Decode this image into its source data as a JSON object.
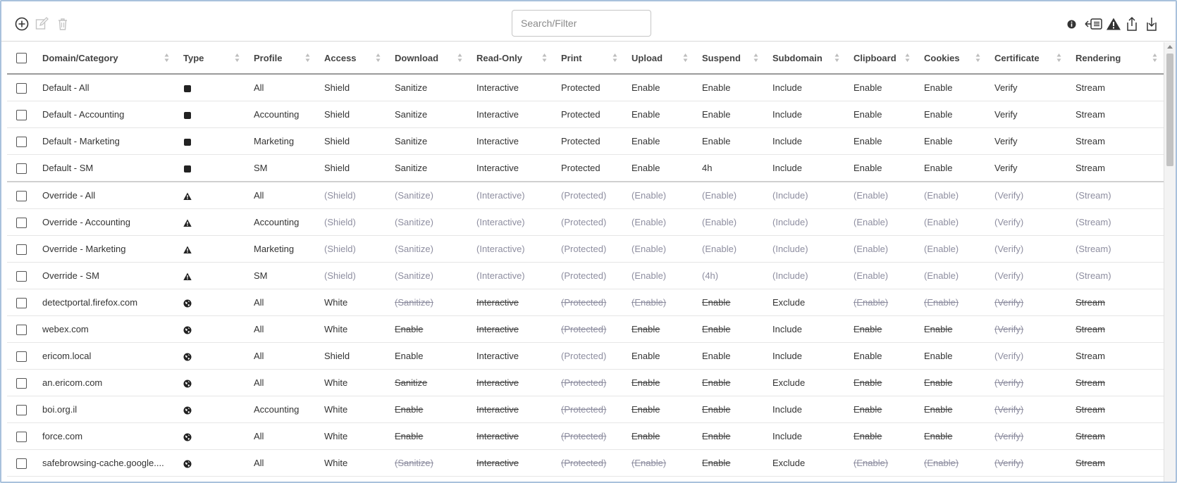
{
  "toolbar": {
    "left_icons": [
      "add-circle-icon",
      "edit-icon",
      "trash-icon"
    ],
    "right_icons": [
      "info-icon",
      "import-list-icon",
      "warning-icon",
      "share-export-icon",
      "download-import-icon"
    ]
  },
  "search": {
    "placeholder": "Search/Filter",
    "value": ""
  },
  "table": {
    "columns": [
      "Domain/Category",
      "Type",
      "Profile",
      "Access",
      "Download",
      "Read-Only",
      "Print",
      "Upload",
      "Suspend",
      "Subdomain",
      "Clipboard",
      "Cookies",
      "Certificate",
      "Rendering"
    ],
    "rows": [
      {
        "type_icon": "square-icon",
        "cells": [
          [
            "Default - All",
            ""
          ],
          [
            "",
            ""
          ],
          [
            "All",
            ""
          ],
          [
            "Shield",
            ""
          ],
          [
            "Sanitize",
            ""
          ],
          [
            "Interactive",
            ""
          ],
          [
            "Protected",
            ""
          ],
          [
            "Enable",
            ""
          ],
          [
            "Enable",
            ""
          ],
          [
            "Include",
            ""
          ],
          [
            "Enable",
            ""
          ],
          [
            "Enable",
            ""
          ],
          [
            "Verify",
            ""
          ],
          [
            "Stream",
            ""
          ]
        ]
      },
      {
        "type_icon": "square-icon",
        "cells": [
          [
            "Default - Accounting",
            ""
          ],
          [
            "",
            ""
          ],
          [
            "Accounting",
            ""
          ],
          [
            "Shield",
            ""
          ],
          [
            "Sanitize",
            ""
          ],
          [
            "Interactive",
            ""
          ],
          [
            "Protected",
            ""
          ],
          [
            "Enable",
            ""
          ],
          [
            "Enable",
            ""
          ],
          [
            "Include",
            ""
          ],
          [
            "Enable",
            ""
          ],
          [
            "Enable",
            ""
          ],
          [
            "Verify",
            ""
          ],
          [
            "Stream",
            ""
          ]
        ]
      },
      {
        "type_icon": "square-icon",
        "cells": [
          [
            "Default - Marketing",
            ""
          ],
          [
            "",
            ""
          ],
          [
            "Marketing",
            ""
          ],
          [
            "Shield",
            ""
          ],
          [
            "Sanitize",
            ""
          ],
          [
            "Interactive",
            ""
          ],
          [
            "Protected",
            ""
          ],
          [
            "Enable",
            ""
          ],
          [
            "Enable",
            ""
          ],
          [
            "Include",
            ""
          ],
          [
            "Enable",
            ""
          ],
          [
            "Enable",
            ""
          ],
          [
            "Verify",
            ""
          ],
          [
            "Stream",
            ""
          ]
        ]
      },
      {
        "type_icon": "square-icon",
        "group_end": true,
        "cells": [
          [
            "Default - SM",
            ""
          ],
          [
            "",
            ""
          ],
          [
            "SM",
            ""
          ],
          [
            "Shield",
            ""
          ],
          [
            "Sanitize",
            ""
          ],
          [
            "Interactive",
            ""
          ],
          [
            "Protected",
            ""
          ],
          [
            "Enable",
            ""
          ],
          [
            "4h",
            ""
          ],
          [
            "Include",
            ""
          ],
          [
            "Enable",
            ""
          ],
          [
            "Enable",
            ""
          ],
          [
            "Verify",
            ""
          ],
          [
            "Stream",
            ""
          ]
        ]
      },
      {
        "type_icon": "warning-icon",
        "cells": [
          [
            "Override - All",
            ""
          ],
          [
            "",
            ""
          ],
          [
            "All",
            ""
          ],
          [
            "(Shield)",
            "i"
          ],
          [
            "(Sanitize)",
            "i"
          ],
          [
            "(Interactive)",
            "i"
          ],
          [
            "(Protected)",
            "i"
          ],
          [
            "(Enable)",
            "i"
          ],
          [
            "(Enable)",
            "i"
          ],
          [
            "(Include)",
            "i"
          ],
          [
            "(Enable)",
            "i"
          ],
          [
            "(Enable)",
            "i"
          ],
          [
            "(Verify)",
            "i"
          ],
          [
            "(Stream)",
            "i"
          ]
        ]
      },
      {
        "type_icon": "warning-icon",
        "cells": [
          [
            "Override - Accounting",
            ""
          ],
          [
            "",
            ""
          ],
          [
            "Accounting",
            ""
          ],
          [
            "(Shield)",
            "i"
          ],
          [
            "(Sanitize)",
            "i"
          ],
          [
            "(Interactive)",
            "i"
          ],
          [
            "(Protected)",
            "i"
          ],
          [
            "(Enable)",
            "i"
          ],
          [
            "(Enable)",
            "i"
          ],
          [
            "(Include)",
            "i"
          ],
          [
            "(Enable)",
            "i"
          ],
          [
            "(Enable)",
            "i"
          ],
          [
            "(Verify)",
            "i"
          ],
          [
            "(Stream)",
            "i"
          ]
        ]
      },
      {
        "type_icon": "warning-icon",
        "cells": [
          [
            "Override - Marketing",
            ""
          ],
          [
            "",
            ""
          ],
          [
            "Marketing",
            ""
          ],
          [
            "(Shield)",
            "i"
          ],
          [
            "(Sanitize)",
            "i"
          ],
          [
            "(Interactive)",
            "i"
          ],
          [
            "(Protected)",
            "i"
          ],
          [
            "(Enable)",
            "i"
          ],
          [
            "(Enable)",
            "i"
          ],
          [
            "(Include)",
            "i"
          ],
          [
            "(Enable)",
            "i"
          ],
          [
            "(Enable)",
            "i"
          ],
          [
            "(Verify)",
            "i"
          ],
          [
            "(Stream)",
            "i"
          ]
        ]
      },
      {
        "type_icon": "warning-icon",
        "cells": [
          [
            "Override - SM",
            ""
          ],
          [
            "",
            ""
          ],
          [
            "SM",
            ""
          ],
          [
            "(Shield)",
            "i"
          ],
          [
            "(Sanitize)",
            "i"
          ],
          [
            "(Interactive)",
            "i"
          ],
          [
            "(Protected)",
            "i"
          ],
          [
            "(Enable)",
            "i"
          ],
          [
            "(4h)",
            "i"
          ],
          [
            "(Include)",
            "i"
          ],
          [
            "(Enable)",
            "i"
          ],
          [
            "(Enable)",
            "i"
          ],
          [
            "(Verify)",
            "i"
          ],
          [
            "(Stream)",
            "i"
          ]
        ]
      },
      {
        "type_icon": "globe-icon",
        "cells": [
          [
            "detectportal.firefox.com",
            ""
          ],
          [
            "",
            ""
          ],
          [
            "All",
            ""
          ],
          [
            "White",
            ""
          ],
          [
            "(Sanitize)",
            "si"
          ],
          [
            "Interactive",
            "s"
          ],
          [
            "(Protected)",
            "si"
          ],
          [
            "(Enable)",
            "si"
          ],
          [
            "Enable",
            "s"
          ],
          [
            "Exclude",
            ""
          ],
          [
            "(Enable)",
            "si"
          ],
          [
            "(Enable)",
            "si"
          ],
          [
            "(Verify)",
            "si"
          ],
          [
            "Stream",
            "s"
          ]
        ]
      },
      {
        "type_icon": "globe-icon",
        "cells": [
          [
            "webex.com",
            ""
          ],
          [
            "",
            ""
          ],
          [
            "All",
            ""
          ],
          [
            "White",
            ""
          ],
          [
            "Enable",
            "s"
          ],
          [
            "Interactive",
            "s"
          ],
          [
            "(Protected)",
            "si"
          ],
          [
            "Enable",
            "s"
          ],
          [
            "Enable",
            "s"
          ],
          [
            "Include",
            ""
          ],
          [
            "Enable",
            "s"
          ],
          [
            "Enable",
            "s"
          ],
          [
            "(Verify)",
            "si"
          ],
          [
            "Stream",
            "s"
          ]
        ]
      },
      {
        "type_icon": "globe-icon",
        "cells": [
          [
            "ericom.local",
            ""
          ],
          [
            "",
            ""
          ],
          [
            "All",
            ""
          ],
          [
            "Shield",
            ""
          ],
          [
            "Enable",
            ""
          ],
          [
            "Interactive",
            ""
          ],
          [
            "(Protected)",
            "i"
          ],
          [
            "Enable",
            ""
          ],
          [
            "Enable",
            ""
          ],
          [
            "Include",
            ""
          ],
          [
            "Enable",
            ""
          ],
          [
            "Enable",
            ""
          ],
          [
            "(Verify)",
            "i"
          ],
          [
            "Stream",
            ""
          ]
        ]
      },
      {
        "type_icon": "globe-icon",
        "cells": [
          [
            "an.ericom.com",
            ""
          ],
          [
            "",
            ""
          ],
          [
            "All",
            ""
          ],
          [
            "White",
            ""
          ],
          [
            "Sanitize",
            "s"
          ],
          [
            "Interactive",
            "s"
          ],
          [
            "(Protected)",
            "si"
          ],
          [
            "Enable",
            "s"
          ],
          [
            "Enable",
            "s"
          ],
          [
            "Exclude",
            ""
          ],
          [
            "Enable",
            "s"
          ],
          [
            "Enable",
            "s"
          ],
          [
            "(Verify)",
            "si"
          ],
          [
            "Stream",
            "s"
          ]
        ]
      },
      {
        "type_icon": "globe-icon",
        "cells": [
          [
            "boi.org.il",
            ""
          ],
          [
            "",
            ""
          ],
          [
            "Accounting",
            ""
          ],
          [
            "White",
            ""
          ],
          [
            "Enable",
            "s"
          ],
          [
            "Interactive",
            "s"
          ],
          [
            "(Protected)",
            "si"
          ],
          [
            "Enable",
            "s"
          ],
          [
            "Enable",
            "s"
          ],
          [
            "Include",
            ""
          ],
          [
            "Enable",
            "s"
          ],
          [
            "Enable",
            "s"
          ],
          [
            "(Verify)",
            "si"
          ],
          [
            "Stream",
            "s"
          ]
        ]
      },
      {
        "type_icon": "globe-icon",
        "cells": [
          [
            "force.com",
            ""
          ],
          [
            "",
            ""
          ],
          [
            "All",
            ""
          ],
          [
            "White",
            ""
          ],
          [
            "Enable",
            "s"
          ],
          [
            "Interactive",
            "s"
          ],
          [
            "(Protected)",
            "si"
          ],
          [
            "Enable",
            "s"
          ],
          [
            "Enable",
            "s"
          ],
          [
            "Include",
            ""
          ],
          [
            "Enable",
            "s"
          ],
          [
            "Enable",
            "s"
          ],
          [
            "(Verify)",
            "si"
          ],
          [
            "Stream",
            "s"
          ]
        ]
      },
      {
        "type_icon": "globe-icon",
        "cells": [
          [
            "safebrowsing-cache.google....",
            ""
          ],
          [
            "",
            ""
          ],
          [
            "All",
            ""
          ],
          [
            "White",
            ""
          ],
          [
            "(Sanitize)",
            "si"
          ],
          [
            "Interactive",
            "s"
          ],
          [
            "(Protected)",
            "si"
          ],
          [
            "(Enable)",
            "si"
          ],
          [
            "Enable",
            "s"
          ],
          [
            "Exclude",
            ""
          ],
          [
            "(Enable)",
            "si"
          ],
          [
            "(Enable)",
            "si"
          ],
          [
            "(Verify)",
            "si"
          ],
          [
            "Stream",
            "s"
          ]
        ]
      }
    ]
  }
}
